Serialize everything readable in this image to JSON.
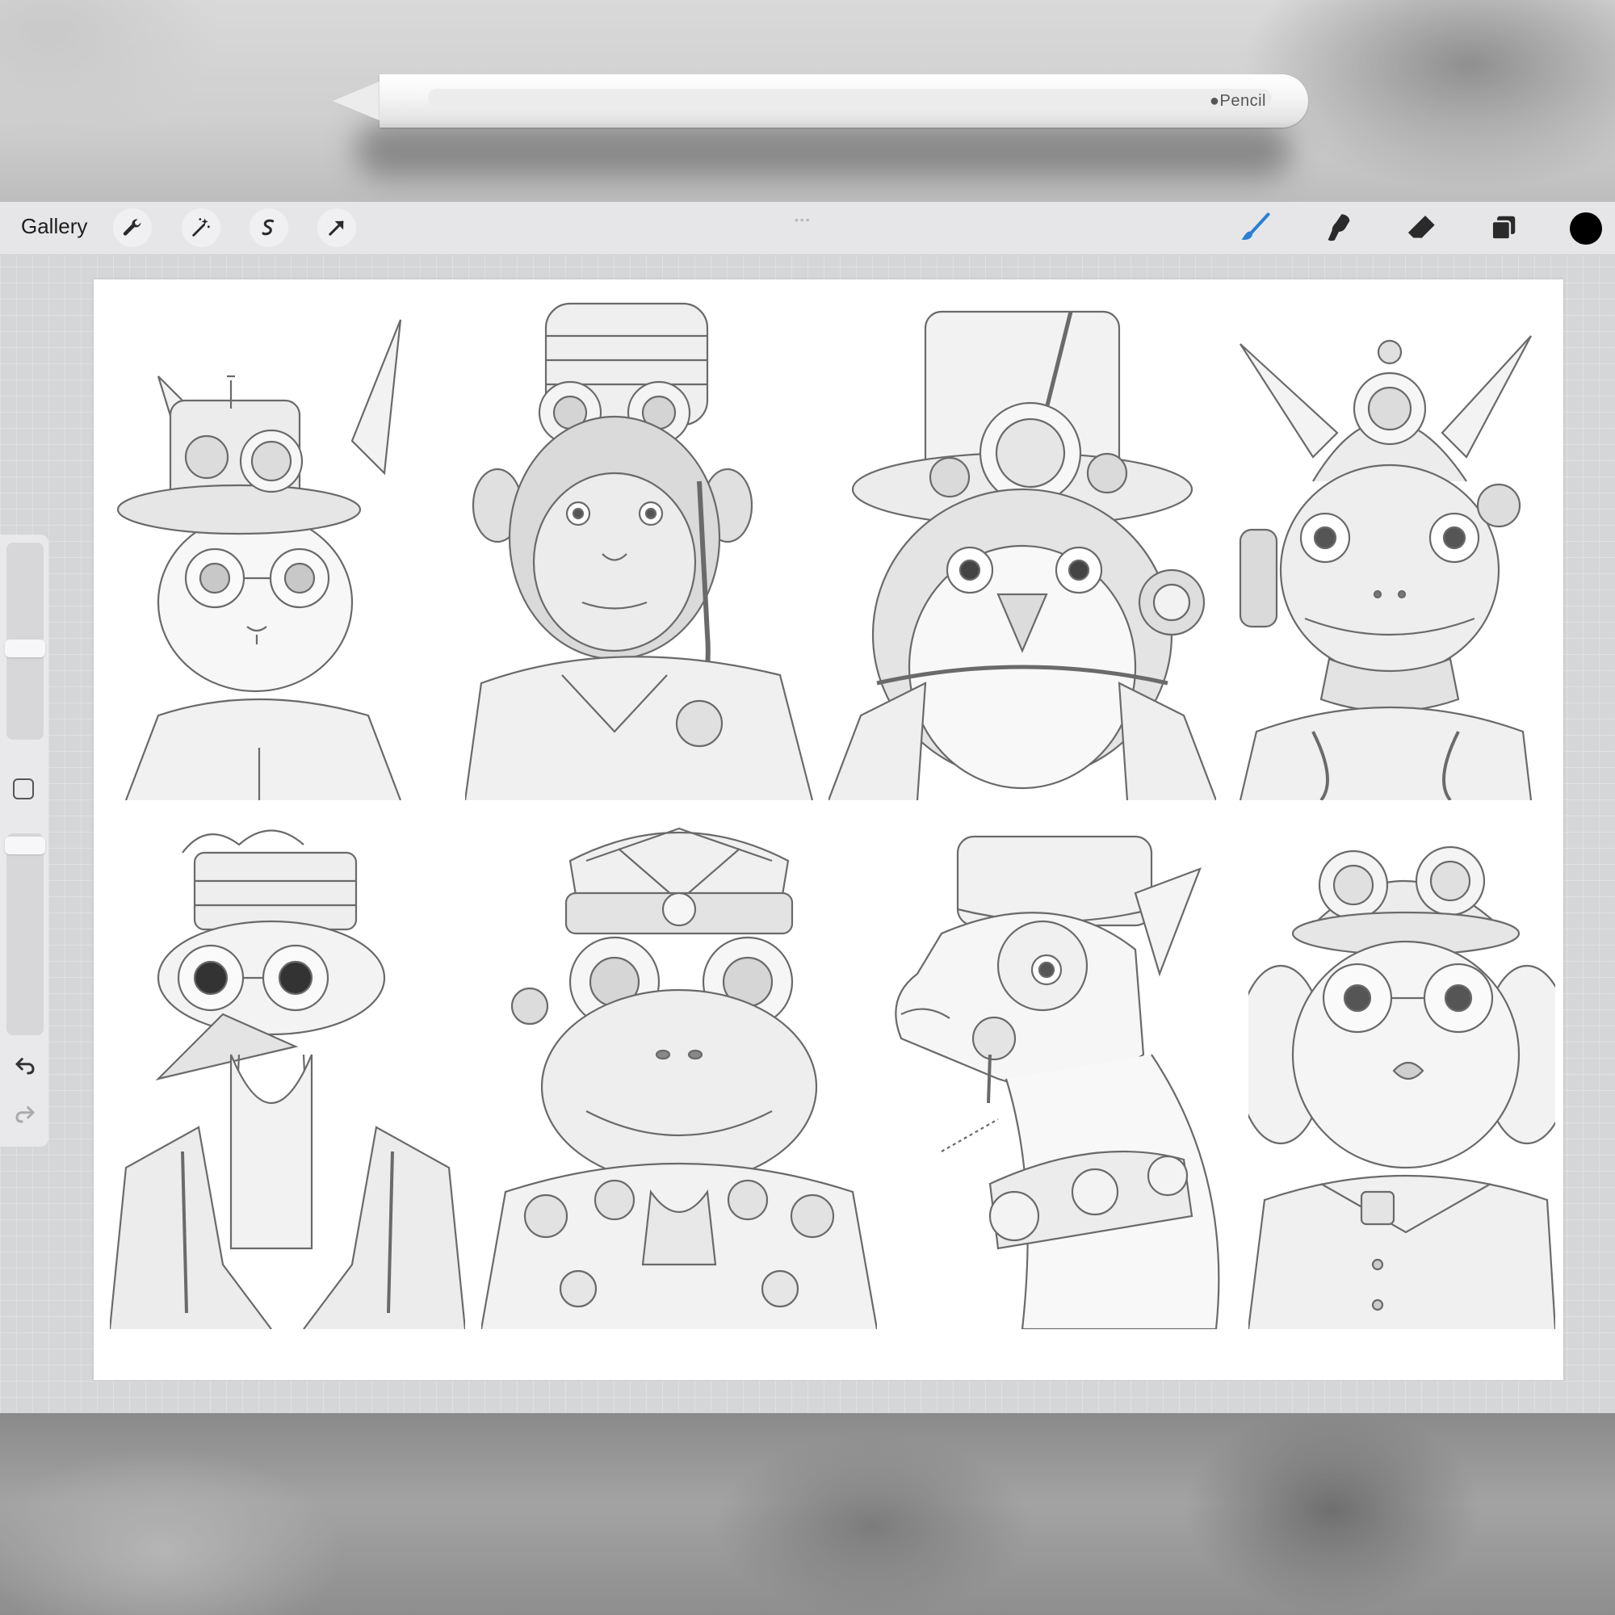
{
  "pencil": {
    "brand_label": "Pencil"
  },
  "toolbar": {
    "gallery_label": "Gallery",
    "left_tools": [
      "wrench-icon",
      "magic-wand-icon",
      "selection-icon",
      "transform-arrow-icon"
    ],
    "right_tools": [
      "brush-icon",
      "smudge-icon",
      "eraser-icon",
      "layers-icon"
    ],
    "active_tool": "brush",
    "accent_color": "#2a7fd4",
    "current_color": "#000000"
  },
  "sidebar": {
    "icons": [
      "brush-size-slider",
      "modify-button",
      "opacity-slider",
      "undo-icon",
      "redo-icon"
    ]
  },
  "canvas": {
    "background": "#ffffff",
    "portraits": [
      {
        "subject": "steampunk-cat-portrait"
      },
      {
        "subject": "steampunk-chimpanzee-portrait"
      },
      {
        "subject": "steampunk-penguin-portrait"
      },
      {
        "subject": "steampunk-lizard-portrait"
      },
      {
        "subject": "steampunk-ostrich-portrait"
      },
      {
        "subject": "steampunk-frog-portrait"
      },
      {
        "subject": "steampunk-llama-portrait"
      },
      {
        "subject": "steampunk-dog-portrait"
      }
    ]
  }
}
